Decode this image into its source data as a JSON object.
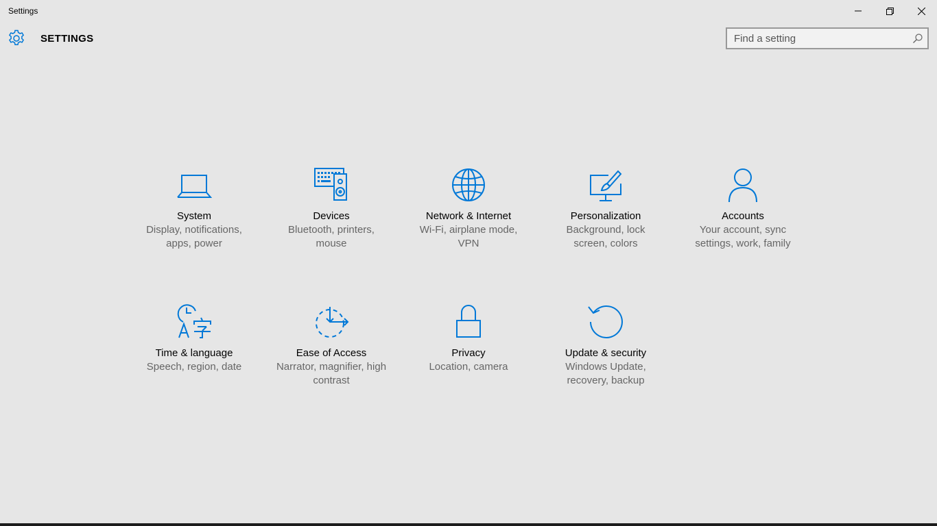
{
  "window": {
    "title": "Settings",
    "controls": {
      "minimize_icon": "minimize-icon",
      "maximize_icon": "restore-icon",
      "close_icon": "close-icon"
    }
  },
  "header": {
    "icon": "gear-icon",
    "title": "SETTINGS",
    "search": {
      "placeholder": "Find a setting",
      "value": "",
      "icon": "search-icon"
    }
  },
  "accent_color": "#0078d7",
  "categories": [
    {
      "id": "system",
      "icon": "laptop-icon",
      "title": "System",
      "desc": "Display, notifications, apps, power"
    },
    {
      "id": "devices",
      "icon": "devices-icon",
      "title": "Devices",
      "desc": "Bluetooth, printers, mouse"
    },
    {
      "id": "network",
      "icon": "globe-icon",
      "title": "Network & Internet",
      "desc": "Wi-Fi, airplane mode, VPN"
    },
    {
      "id": "personalization",
      "icon": "personalization-icon",
      "title": "Personalization",
      "desc": "Background, lock screen, colors"
    },
    {
      "id": "accounts",
      "icon": "person-icon",
      "title": "Accounts",
      "desc": "Your account, sync settings, work, family"
    },
    {
      "id": "time-language",
      "icon": "time-language-icon",
      "title": "Time & language",
      "desc": "Speech, region, date"
    },
    {
      "id": "ease-of-access",
      "icon": "ease-of-access-icon",
      "title": "Ease of Access",
      "desc": "Narrator, magnifier, high contrast"
    },
    {
      "id": "privacy",
      "icon": "lock-icon",
      "title": "Privacy",
      "desc": "Location, camera"
    },
    {
      "id": "update-security",
      "icon": "refresh-icon",
      "title": "Update & security",
      "desc": "Windows Update, recovery, backup"
    }
  ]
}
